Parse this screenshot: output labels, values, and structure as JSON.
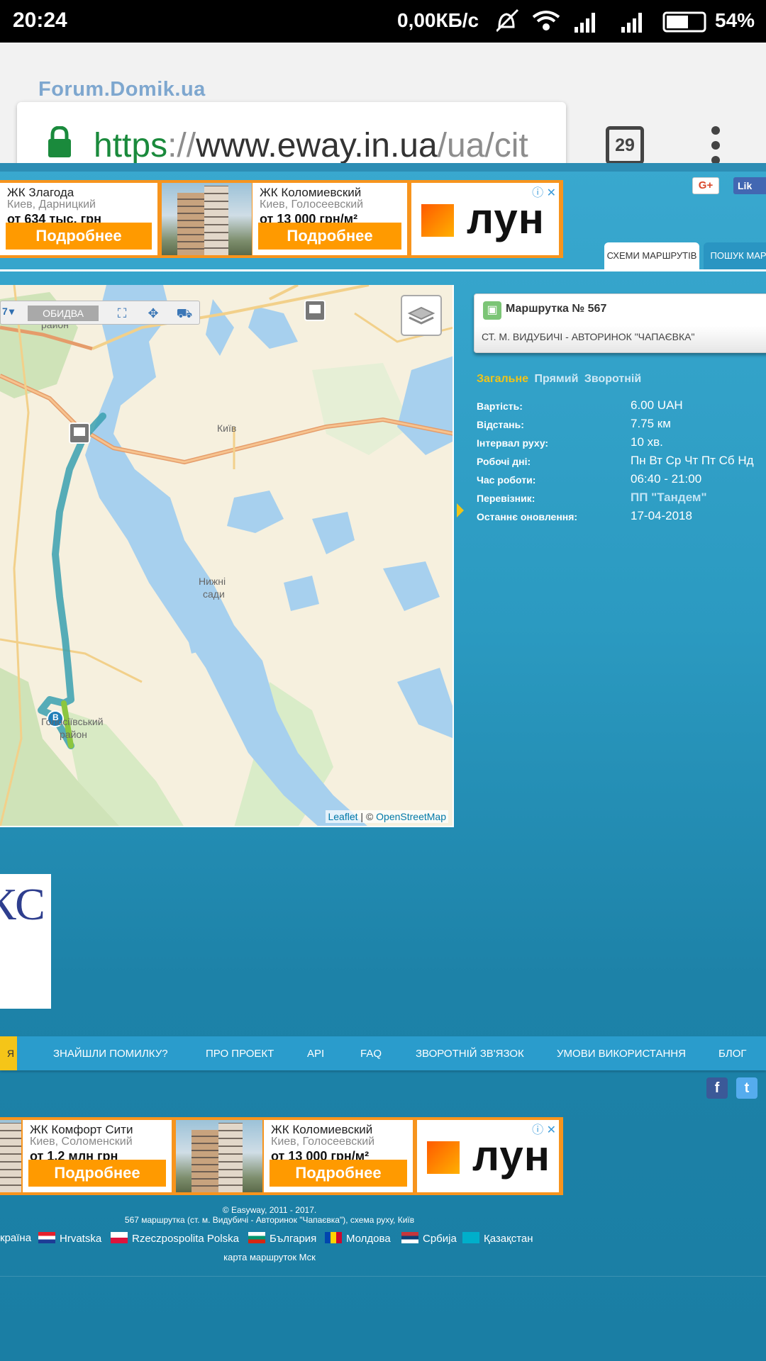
{
  "status_bar": {
    "time": "20:24",
    "net_speed": "0,00КБ/с",
    "battery": "54%"
  },
  "browser": {
    "overlay_logo": "Forum.Domik.ua",
    "url": {
      "scheme": "https",
      "separator": "://",
      "host": "www.eway.in.ua",
      "path": "/ua/cit"
    },
    "tab_count": "29"
  },
  "ads_top": {
    "items": [
      {
        "title": "ЖК Злагода",
        "location": "Киев, Дарницкий",
        "price": "от 634 тыс. грн",
        "button": "Подробнее"
      },
      {
        "title": "ЖК Коломиевский",
        "location": "Киев, Голосеевский",
        "price": "от 13 000 грн/м²",
        "button": "Подробнее"
      }
    ],
    "brand": "лун"
  },
  "social_top": {
    "gplus": "G+",
    "like": "Lik"
  },
  "page_tabs": {
    "schemes": "СХЕМИ МАРШРУТІВ",
    "search": "ПОШУК МАРШ"
  },
  "map": {
    "toolbar": {
      "zoom": "7",
      "mode": "ОБИДВА"
    },
    "labels": {
      "district1": "район",
      "kyiv": "Київ",
      "nizhni1": "Нижні",
      "nizhni2": "сади",
      "holosiiv1": "Голосіївський",
      "holosiiv2": "район",
      "marker_b": "B"
    },
    "attribution": {
      "leaflet": "Leaflet",
      "divider": " | © ",
      "osm": "OpenStreetMap"
    }
  },
  "route": {
    "name": "Маршрутка № 567",
    "description": "СТ. М. ВИДУБИЧІ - АВТОРИНОК \"ЧАПАЄВКА\"",
    "tabs": [
      "Загальне",
      "Прямий",
      "Зворотній"
    ],
    "info": [
      {
        "label": "Вартість:",
        "value": "6.00 UAH"
      },
      {
        "label": "Відстань:",
        "value": "7.75 км"
      },
      {
        "label": "Інтервал руху:",
        "value": "10 хв."
      },
      {
        "label": "Робочі дні:",
        "value": "Пн Вт Ср Чт Пт Сб Нд"
      },
      {
        "label": "Час роботи:",
        "value": "06:40 - 21:00"
      },
      {
        "label": "Перевізник:",
        "value": "ПП \"Тандем\""
      },
      {
        "label": "Останнє оновлення:",
        "value": "17-04-2018"
      }
    ]
  },
  "side_card": {
    "text": "КС"
  },
  "footer_nav": {
    "first": "Я",
    "items": [
      "ЗНАЙШЛИ ПОМИЛКУ?",
      "ПРО ПРОЕКТ",
      "API",
      "FAQ",
      "ЗВОРОТНІЙ ЗВ'ЯЗОК",
      "УМОВИ ВИКОРИСТАННЯ",
      "БЛОГ"
    ]
  },
  "social_bottom": {
    "facebook": "f",
    "twitter": "t"
  },
  "ads_bottom": {
    "items": [
      {
        "title": "ЖК Комфорт Сити",
        "location": "Киев, Соломенский",
        "price": "от 1.2 млн грн",
        "button": "Подробнее"
      },
      {
        "title": "ЖК Коломиевский",
        "location": "Киев, Голосеевский",
        "price": "от 13 000 грн/м²",
        "button": "Подробнее"
      }
    ],
    "brand": "лун"
  },
  "footer": {
    "copyright": "© Easyway, 2011 - 2017.",
    "caption": "567 маршрутка (ст. м. Видубичі - Авторинок \"Чапаєвка\"), схема руху, Київ",
    "languages": [
      "країна",
      "Hrvatska",
      "Rzeczpospolita Polska",
      "България",
      "Молдова",
      "Србија",
      "Қазақстан"
    ],
    "extra_link": "карта маршруток Мск"
  }
}
